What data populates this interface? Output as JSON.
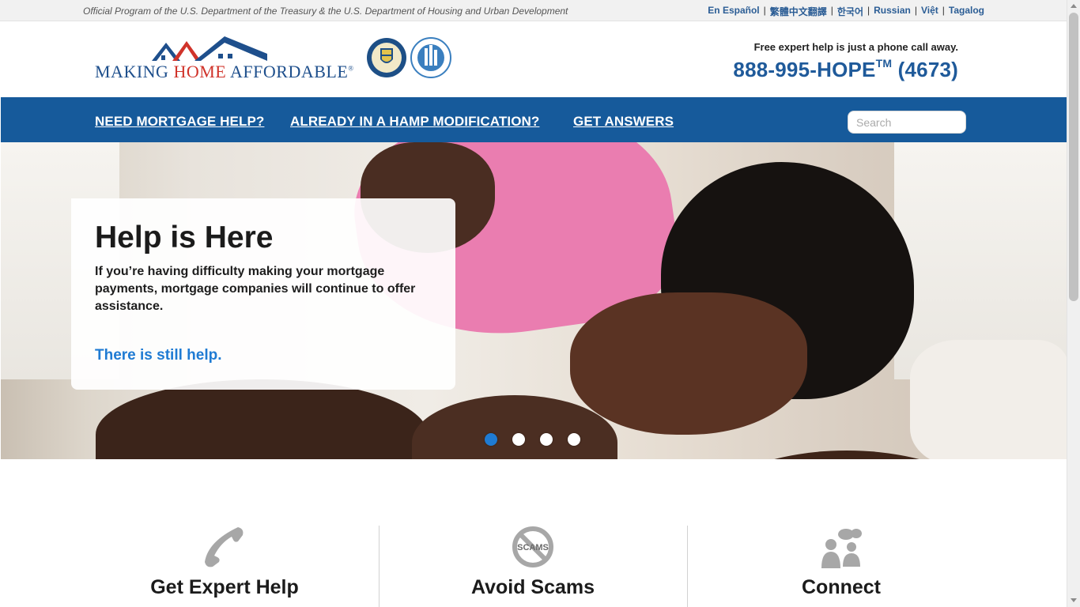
{
  "topbar": {
    "official_text": "Official Program of the U.S. Department of the Treasury & the U.S. Department of Housing and Urban Development",
    "languages": [
      "En Español",
      "繁體中文翻譯",
      "한국어",
      "Russian",
      "Việt",
      "Tagalog"
    ],
    "separator": "|"
  },
  "header": {
    "logo_text_1": "MAKING ",
    "logo_text_2": "HOME",
    "logo_text_3": " AFFORDABLE",
    "logo_registered": "®",
    "seals": [
      "treasury-seal-icon",
      "hud-seal-icon"
    ],
    "callout_note": "Free expert help is just a phone call away.",
    "phone_main": "888-995-HOPE",
    "phone_tm": "TM",
    "phone_digits": " (4673)"
  },
  "nav": {
    "items": [
      "NEED MORTGAGE HELP?",
      "ALREADY IN A HAMP MODIFICATION?",
      "GET ANSWERS"
    ],
    "search_placeholder": "Search"
  },
  "hero": {
    "title": "Help is Here",
    "body": "If you’re having difficulty making your mortgage payments, mortgage companies will continue to offer assistance.",
    "link": "There is still help.",
    "slides": 4,
    "active_slide": 1
  },
  "features": [
    {
      "title": "Get Expert Help",
      "icon": "phone-icon"
    },
    {
      "title": "Avoid Scams",
      "icon": "no-scams-icon",
      "icon_text": "SCAMS"
    },
    {
      "title": "Connect",
      "icon": "people-chat-icon"
    }
  ],
  "colors": {
    "nav_blue": "#165a9b",
    "link_blue": "#1f7bd3",
    "logo_red": "#d0332a",
    "logo_blue": "#1e4f8c"
  }
}
